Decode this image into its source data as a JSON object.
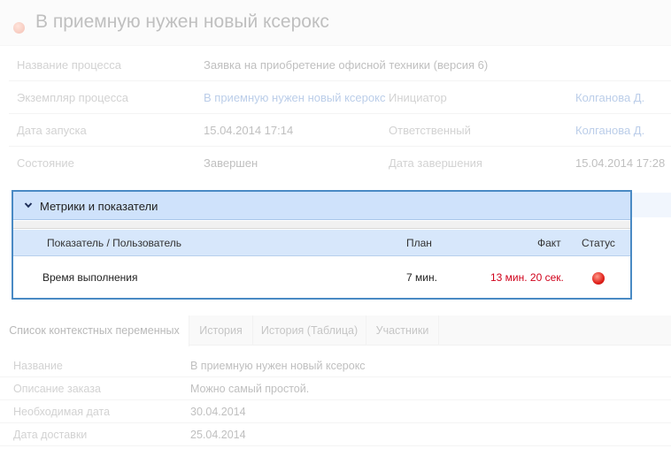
{
  "header": {
    "title": "В приемную нужен новый ксерокс"
  },
  "info": {
    "rows": [
      {
        "label": "Название процесса",
        "value": "Заявка на приобретение офисной техники (версия 6)"
      },
      {
        "label": "Экземпляр процесса",
        "value": "В приемную нужен новый ксерокс",
        "label2": "Инициатор",
        "value2": "Колганова Д."
      },
      {
        "label": "Дата запуска",
        "value": "15.04.2014 17:14",
        "label2": "Ответственный",
        "value2": "Колганова Д."
      },
      {
        "label": "Состояние",
        "value": "Завершен",
        "label2": "Дата завершения",
        "value2": "15.04.2014 17:28"
      }
    ]
  },
  "metrics": {
    "title": "Метрики и показатели",
    "columns": [
      "Показатель / Пользователь",
      "План",
      "Факт",
      "Статус"
    ],
    "rows": [
      {
        "name": "Время выполнения",
        "plan": "7 мин.",
        "fact": "13 мин. 20 сек.",
        "status_color": "#e0201a"
      }
    ]
  },
  "tabs": [
    {
      "label": "Список контекстных переменных",
      "active": true
    },
    {
      "label": "История",
      "active": false
    },
    {
      "label": "История (Таблица)",
      "active": false
    },
    {
      "label": "Участники",
      "active": false
    }
  ],
  "variables": [
    {
      "label": "Название",
      "value": "В приемную нужен новый ксерокс"
    },
    {
      "label": "Описание заказа",
      "value": "Можно самый простой."
    },
    {
      "label": "Необходимая дата",
      "value": "30.04.2014"
    },
    {
      "label": "Дата доставки",
      "value": "25.04.2014"
    }
  ],
  "colors": {
    "accent_border": "#4a8ac4",
    "panel_header": "#cfe2fb",
    "link": "#4a7cc4",
    "overdue": "#d0021b"
  }
}
